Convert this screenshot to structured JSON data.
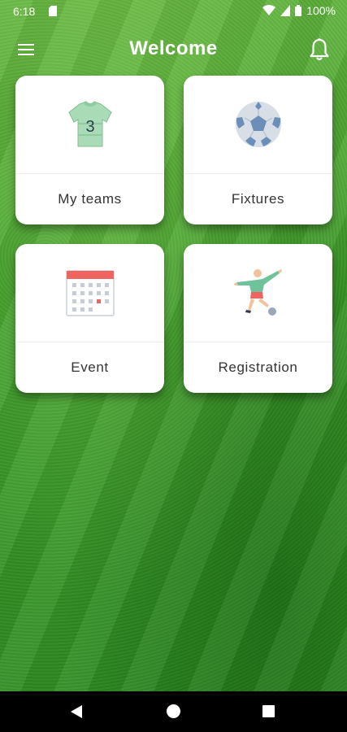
{
  "status_bar": {
    "time": "6:18",
    "battery": "100%"
  },
  "header": {
    "title": "Welcome",
    "menu_icon": "hamburger-menu-icon",
    "notification_icon": "bell-icon"
  },
  "cards": [
    {
      "label": "My teams",
      "icon": "jersey-icon",
      "jersey_number": "3"
    },
    {
      "label": "Fixtures",
      "icon": "soccer-ball-icon"
    },
    {
      "label": "Event",
      "icon": "calendar-icon"
    },
    {
      "label": "Registration",
      "icon": "soccer-player-icon"
    }
  ],
  "colors": {
    "accent_green": "#a8d8b0",
    "calendar_red": "#ef6461",
    "ball_blue": "#6b8fb8"
  }
}
